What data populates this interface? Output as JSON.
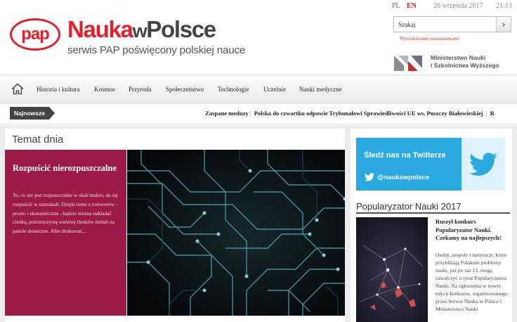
{
  "brand": {
    "logo_mark": "pap",
    "title_part1": "Nauka",
    "title_part2": "w",
    "title_part3": "Polsce",
    "subtitle": "serwis PAP poświęcony polskiej nauce",
    "accent_color": "#e5202b"
  },
  "topbar": {
    "lang_pl": "PL",
    "lang_en": "EN",
    "date": "26 września 2017",
    "time": "21:13"
  },
  "search": {
    "value": "Szukaj",
    "button_icon": "chevron-right-icon",
    "advanced_link": "Wyszukiwanie zaawansowane"
  },
  "ministry": {
    "line1": "Ministerstwo Nauki",
    "line2": "i Szkolnictwa Wyższego"
  },
  "nav": {
    "home_icon": "home-icon",
    "items": [
      "Historia i kultura",
      "Kosmos",
      "Przyroda",
      "Społeczeństwo",
      "Technologie",
      "Uczelnie",
      "Nauki medyczne"
    ]
  },
  "ticker": {
    "label": "Najnowsze",
    "items": [
      "Zaspane meduzy",
      "Polska do czwartku odpowie Trybunałowi Sprawiedliwości UE ws. Puszczy Białowieskiej",
      "R"
    ],
    "separator": "|"
  },
  "topic": {
    "section_title": "Temat dnia",
    "headline": "Rozpuścić nierozpuszczalne",
    "lead": "To, co nie jest rozpuszczalne w skali makro, da się rozpuścić w nanoskali. Dzięki temu z roztworów - prosto i ekonomicznie - będzie można nakładać cienką, przezroczystą warstwę tlenków metali na panele słoneczne. Albo drukować...",
    "card_color": "#9c1a47"
  },
  "twitter": {
    "follow_text": "Śledź nas na Twitterze",
    "handle": "@naukawpolsce",
    "brand_color": "#2aa8e0",
    "icon": "twitter-bird-icon"
  },
  "popularizer": {
    "section_title": "Popularyzator Nauki 2017",
    "headline": "Ruszył konkurs Popularyzator Nauki. Czekamy na najlepszych!",
    "body": "Osoby, zespoły i instytucje, które przybliżają Polakom problemy nauki, już po raz 13. mogą zawalczyć o tytuł Popularyzatora Nauki. Na zgłoszenia w nowej edycji konkursu, organizowanego przez Serwis Nauka w Polsce i Ministerstwo Nauki"
  }
}
